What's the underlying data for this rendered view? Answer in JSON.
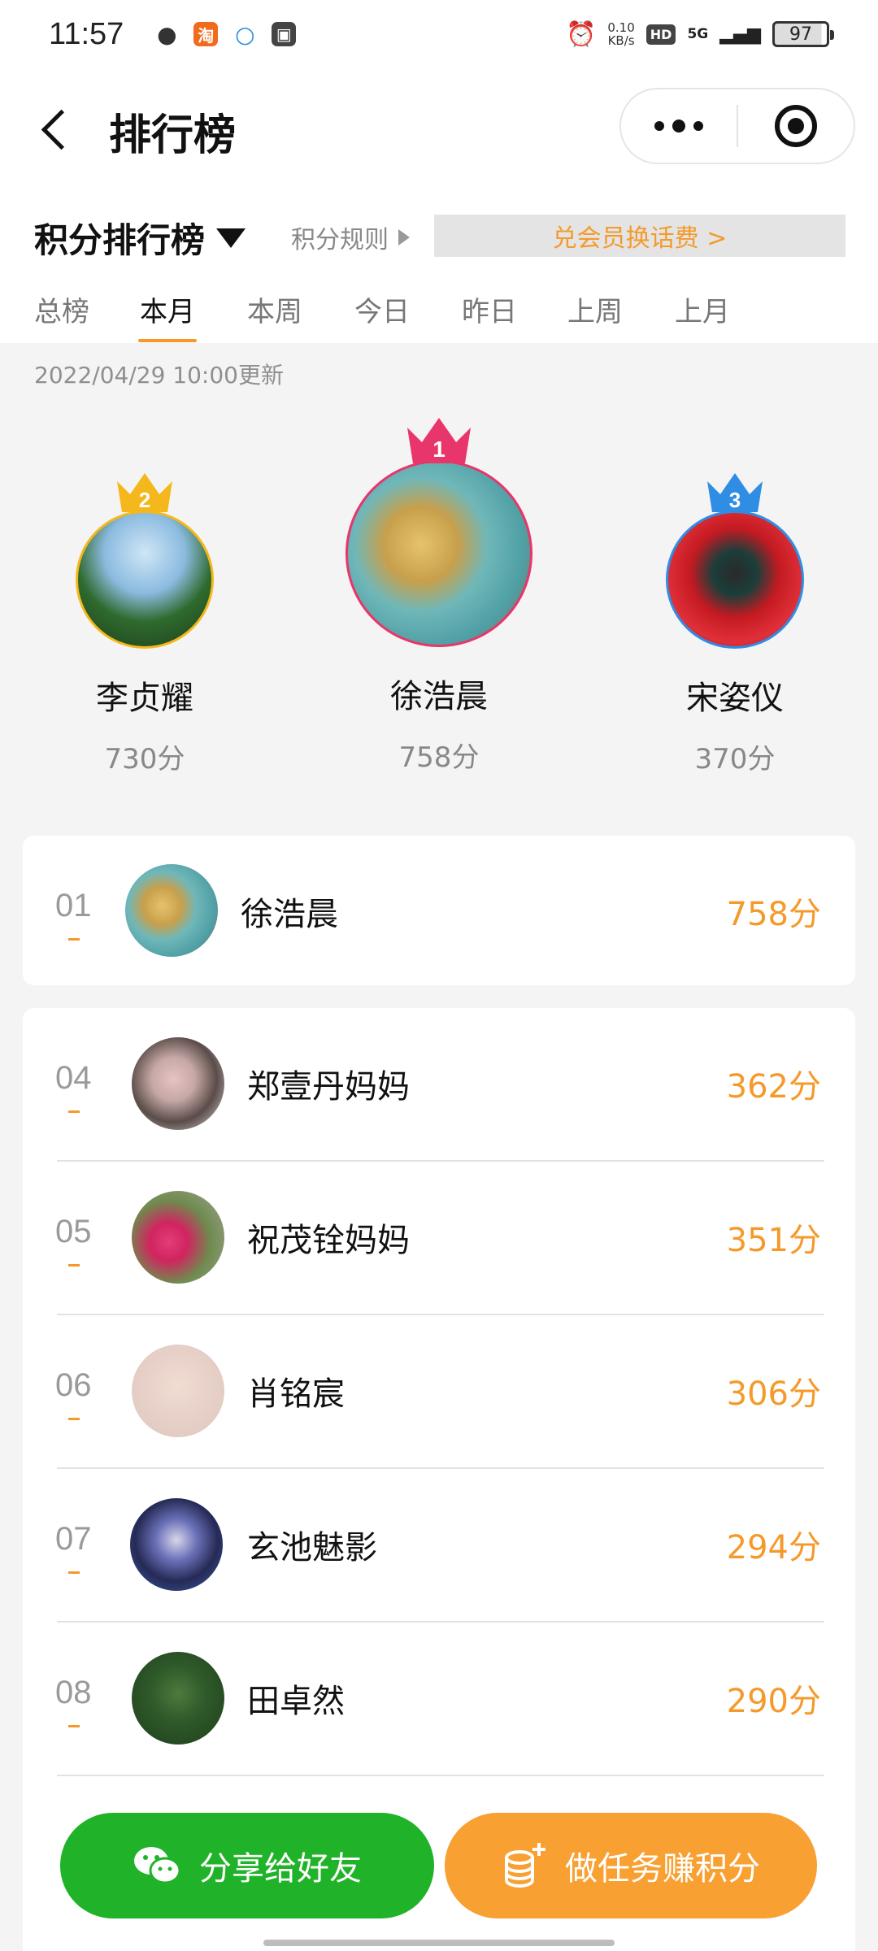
{
  "status_bar": {
    "time": "11:57",
    "net_speed": "0.10",
    "net_unit": "KB/s",
    "hd": "HD",
    "signal": "5G",
    "battery": "97",
    "icons": [
      "wechat-icon",
      "taobao-icon",
      "chat-bubble-icon",
      "shopping-bag-icon",
      "alarm-icon"
    ]
  },
  "header": {
    "title": "排行榜",
    "more_icon": "more-dots-icon",
    "target_icon": "target-icon"
  },
  "rank_selector": {
    "title": "积分排行榜",
    "rules_label": "积分规则",
    "exchange_label": "兑会员换话费 >"
  },
  "tabs": [
    {
      "label": "总榜",
      "active": false
    },
    {
      "label": "本月",
      "active": true
    },
    {
      "label": "本周",
      "active": false
    },
    {
      "label": "今日",
      "active": false
    },
    {
      "label": "昨日",
      "active": false
    },
    {
      "label": "上周",
      "active": false
    },
    {
      "label": "上月",
      "active": false
    }
  ],
  "updated_text": "2022/04/29 10:00更新",
  "podium": {
    "first": {
      "rank": "1",
      "name": "徐浩晨",
      "score": "758分",
      "color": "#e8356a"
    },
    "second": {
      "rank": "2",
      "name": "李贞耀",
      "score": "730分",
      "color": "#f5b81c"
    },
    "third": {
      "rank": "3",
      "name": "宋姿仪",
      "score": "370分",
      "color": "#2f8de4"
    }
  },
  "my_rank": {
    "rank": "01",
    "name": "徐浩晨",
    "score": "758分"
  },
  "list": [
    {
      "rank": "04",
      "name": "郑壹丹妈妈",
      "score": "362分"
    },
    {
      "rank": "05",
      "name": "祝茂铨妈妈",
      "score": "351分"
    },
    {
      "rank": "06",
      "name": "肖铭宸",
      "score": "306分"
    },
    {
      "rank": "07",
      "name": "玄池魅影",
      "score": "294分"
    },
    {
      "rank": "08",
      "name": "田卓然",
      "score": "290分"
    }
  ],
  "footer": {
    "share_label": "分享给好友",
    "task_label": "做任务赚积分"
  },
  "colors": {
    "accent": "#f59a2a",
    "share_green": "#20b329",
    "task_orange": "#f8a032"
  }
}
